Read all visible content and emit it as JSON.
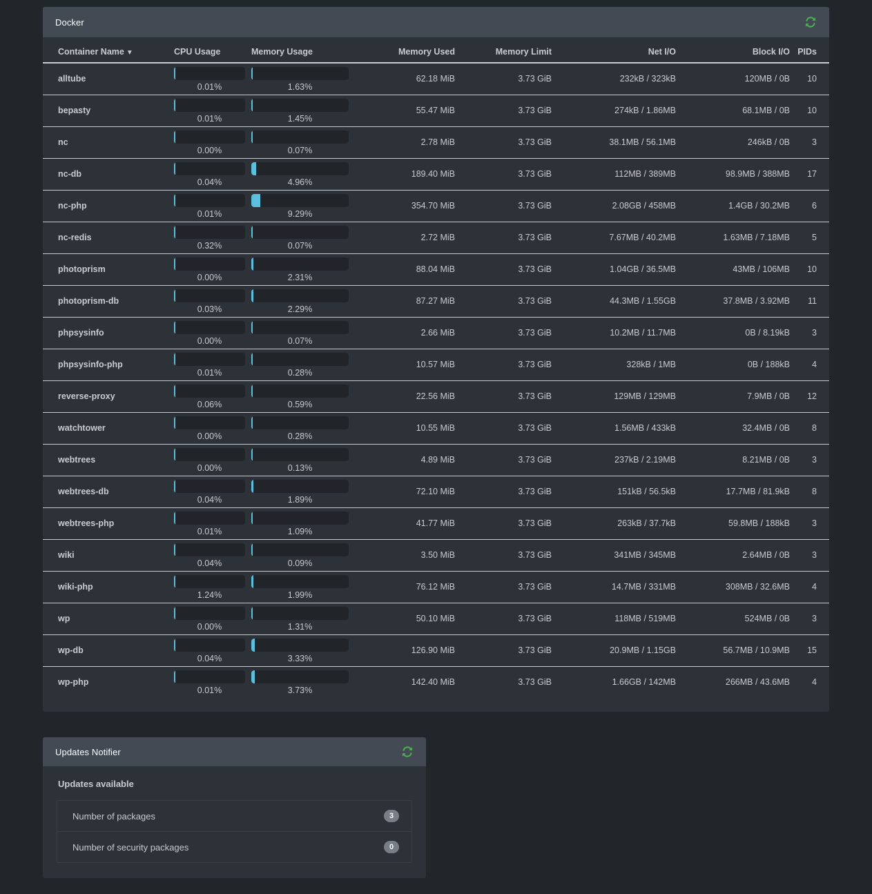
{
  "docker": {
    "title": "Docker",
    "refresh_icon": "refresh-icon",
    "refresh_color": "#4caf50",
    "accent_color": "#5bc0de",
    "columns": [
      "Container Name",
      "CPU Usage",
      "Memory Usage",
      "Memory Used",
      "Memory Limit",
      "Net I/O",
      "Block I/O",
      "PIDs"
    ],
    "sort_indicator": "▼",
    "sorted_column": "Container Name",
    "rows": [
      {
        "name": "alltube",
        "cpu": "0.01%",
        "cpu_pct": 0.01,
        "mem": "1.63%",
        "mem_pct": 1.63,
        "memory_used": "62.18 MiB",
        "memory_limit": "3.73 GiB",
        "net_io": "232kB / 323kB",
        "block_io": "120MB / 0B",
        "pids": "10"
      },
      {
        "name": "bepasty",
        "cpu": "0.01%",
        "cpu_pct": 0.01,
        "mem": "1.45%",
        "mem_pct": 1.45,
        "memory_used": "55.47 MiB",
        "memory_limit": "3.73 GiB",
        "net_io": "274kB / 1.86MB",
        "block_io": "68.1MB / 0B",
        "pids": "10"
      },
      {
        "name": "nc",
        "cpu": "0.00%",
        "cpu_pct": 0.0,
        "mem": "0.07%",
        "mem_pct": 0.07,
        "memory_used": "2.78 MiB",
        "memory_limit": "3.73 GiB",
        "net_io": "38.1MB / 56.1MB",
        "block_io": "246kB / 0B",
        "pids": "3"
      },
      {
        "name": "nc-db",
        "cpu": "0.04%",
        "cpu_pct": 0.04,
        "mem": "4.96%",
        "mem_pct": 4.96,
        "memory_used": "189.40 MiB",
        "memory_limit": "3.73 GiB",
        "net_io": "112MB / 389MB",
        "block_io": "98.9MB / 388MB",
        "pids": "17"
      },
      {
        "name": "nc-php",
        "cpu": "0.01%",
        "cpu_pct": 0.01,
        "mem": "9.29%",
        "mem_pct": 9.29,
        "memory_used": "354.70 MiB",
        "memory_limit": "3.73 GiB",
        "net_io": "2.08GB / 458MB",
        "block_io": "1.4GB / 30.2MB",
        "pids": "6"
      },
      {
        "name": "nc-redis",
        "cpu": "0.32%",
        "cpu_pct": 0.32,
        "mem": "0.07%",
        "mem_pct": 0.07,
        "memory_used": "2.72 MiB",
        "memory_limit": "3.73 GiB",
        "net_io": "7.67MB / 40.2MB",
        "block_io": "1.63MB / 7.18MB",
        "pids": "5"
      },
      {
        "name": "photoprism",
        "cpu": "0.00%",
        "cpu_pct": 0.0,
        "mem": "2.31%",
        "mem_pct": 2.31,
        "memory_used": "88.04 MiB",
        "memory_limit": "3.73 GiB",
        "net_io": "1.04GB / 36.5MB",
        "block_io": "43MB / 106MB",
        "pids": "10"
      },
      {
        "name": "photoprism-db",
        "cpu": "0.03%",
        "cpu_pct": 0.03,
        "mem": "2.29%",
        "mem_pct": 2.29,
        "memory_used": "87.27 MiB",
        "memory_limit": "3.73 GiB",
        "net_io": "44.3MB / 1.55GB",
        "block_io": "37.8MB / 3.92MB",
        "pids": "11"
      },
      {
        "name": "phpsysinfo",
        "cpu": "0.00%",
        "cpu_pct": 0.0,
        "mem": "0.07%",
        "mem_pct": 0.07,
        "memory_used": "2.66 MiB",
        "memory_limit": "3.73 GiB",
        "net_io": "10.2MB / 11.7MB",
        "block_io": "0B / 8.19kB",
        "pids": "3"
      },
      {
        "name": "phpsysinfo-php",
        "cpu": "0.01%",
        "cpu_pct": 0.01,
        "mem": "0.28%",
        "mem_pct": 0.28,
        "memory_used": "10.57 MiB",
        "memory_limit": "3.73 GiB",
        "net_io": "328kB / 1MB",
        "block_io": "0B / 188kB",
        "pids": "4"
      },
      {
        "name": "reverse-proxy",
        "cpu": "0.06%",
        "cpu_pct": 0.06,
        "mem": "0.59%",
        "mem_pct": 0.59,
        "memory_used": "22.56 MiB",
        "memory_limit": "3.73 GiB",
        "net_io": "129MB / 129MB",
        "block_io": "7.9MB / 0B",
        "pids": "12"
      },
      {
        "name": "watchtower",
        "cpu": "0.00%",
        "cpu_pct": 0.0,
        "mem": "0.28%",
        "mem_pct": 0.28,
        "memory_used": "10.55 MiB",
        "memory_limit": "3.73 GiB",
        "net_io": "1.56MB / 433kB",
        "block_io": "32.4MB / 0B",
        "pids": "8"
      },
      {
        "name": "webtrees",
        "cpu": "0.00%",
        "cpu_pct": 0.0,
        "mem": "0.13%",
        "mem_pct": 0.13,
        "memory_used": "4.89 MiB",
        "memory_limit": "3.73 GiB",
        "net_io": "237kB / 2.19MB",
        "block_io": "8.21MB / 0B",
        "pids": "3"
      },
      {
        "name": "webtrees-db",
        "cpu": "0.04%",
        "cpu_pct": 0.04,
        "mem": "1.89%",
        "mem_pct": 1.89,
        "memory_used": "72.10 MiB",
        "memory_limit": "3.73 GiB",
        "net_io": "151kB / 56.5kB",
        "block_io": "17.7MB / 81.9kB",
        "pids": "8"
      },
      {
        "name": "webtrees-php",
        "cpu": "0.01%",
        "cpu_pct": 0.01,
        "mem": "1.09%",
        "mem_pct": 1.09,
        "memory_used": "41.77 MiB",
        "memory_limit": "3.73 GiB",
        "net_io": "263kB / 37.7kB",
        "block_io": "59.8MB / 188kB",
        "pids": "3"
      },
      {
        "name": "wiki",
        "cpu": "0.04%",
        "cpu_pct": 0.04,
        "mem": "0.09%",
        "mem_pct": 0.09,
        "memory_used": "3.50 MiB",
        "memory_limit": "3.73 GiB",
        "net_io": "341MB / 345MB",
        "block_io": "2.64MB / 0B",
        "pids": "3"
      },
      {
        "name": "wiki-php",
        "cpu": "1.24%",
        "cpu_pct": 1.24,
        "mem": "1.99%",
        "mem_pct": 1.99,
        "memory_used": "76.12 MiB",
        "memory_limit": "3.73 GiB",
        "net_io": "14.7MB / 331MB",
        "block_io": "308MB / 32.6MB",
        "pids": "4"
      },
      {
        "name": "wp",
        "cpu": "0.00%",
        "cpu_pct": 0.0,
        "mem": "1.31%",
        "mem_pct": 1.31,
        "memory_used": "50.10 MiB",
        "memory_limit": "3.73 GiB",
        "net_io": "118MB / 519MB",
        "block_io": "524MB / 0B",
        "pids": "3"
      },
      {
        "name": "wp-db",
        "cpu": "0.04%",
        "cpu_pct": 0.04,
        "mem": "3.33%",
        "mem_pct": 3.33,
        "memory_used": "126.90 MiB",
        "memory_limit": "3.73 GiB",
        "net_io": "20.9MB / 1.15GB",
        "block_io": "56.7MB / 10.9MB",
        "pids": "15"
      },
      {
        "name": "wp-php",
        "cpu": "0.01%",
        "cpu_pct": 0.01,
        "mem": "3.73%",
        "mem_pct": 3.73,
        "memory_used": "142.40 MiB",
        "memory_limit": "3.73 GiB",
        "net_io": "1.66GB / 142MB",
        "block_io": "266MB / 43.6MB",
        "pids": "4"
      }
    ]
  },
  "updates": {
    "title": "Updates Notifier",
    "refresh_icon": "refresh-icon",
    "heading": "Updates available",
    "items": [
      {
        "label": "Number of packages",
        "count": "3"
      },
      {
        "label": "Number of security packages",
        "count": "0"
      }
    ]
  }
}
